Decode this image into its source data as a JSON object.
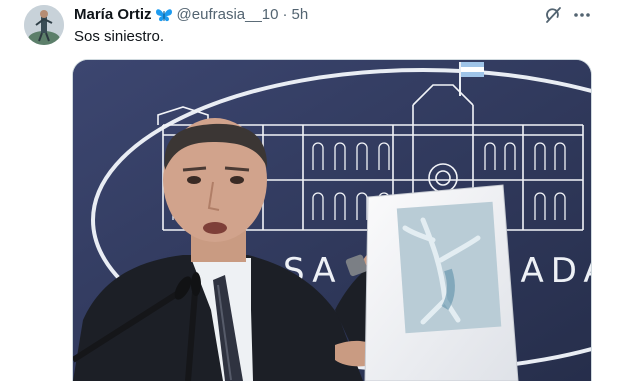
{
  "author": {
    "display_name": "María Ortiz",
    "badge_icon": "butterfly-icon",
    "handle": "@eufrasia__10",
    "separator": "·",
    "time": "5h"
  },
  "tweet": {
    "text": "Sos siniestro."
  },
  "actions": {
    "grok_icon": "grok-icon",
    "more_icon": "more-horizontal-icon"
  },
  "media": {
    "backdrop_text": "SA          ADA",
    "colors": {
      "backdrop": "#323b5e",
      "building_lines": "#f2f4f8",
      "suit": "#1c1f26",
      "paper": "#f3f4f6"
    }
  },
  "colors": {
    "primary_text": "#0f1419",
    "secondary_text": "#536471",
    "badge": "#1d9bf0",
    "border": "#cfd9de"
  }
}
